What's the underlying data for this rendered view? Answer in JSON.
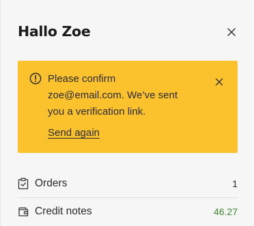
{
  "header": {
    "title": "Hallo Zoe",
    "close_icon": "close-icon"
  },
  "alert": {
    "icon": "warning-circle-icon",
    "lines": [
      "Please confirm",
      "zoe@email.com. We’ve sent",
      "you a verification link."
    ],
    "link_label": "Send again",
    "background": "#fbc22d",
    "close_icon": "close-icon"
  },
  "menu": {
    "items": [
      {
        "icon": "clipboard-check-icon",
        "label": "Orders",
        "count": "1"
      },
      {
        "icon": "wallet-icon",
        "label": "Credit notes",
        "count": "46.27",
        "count_color": "#3a8a2e"
      }
    ]
  }
}
